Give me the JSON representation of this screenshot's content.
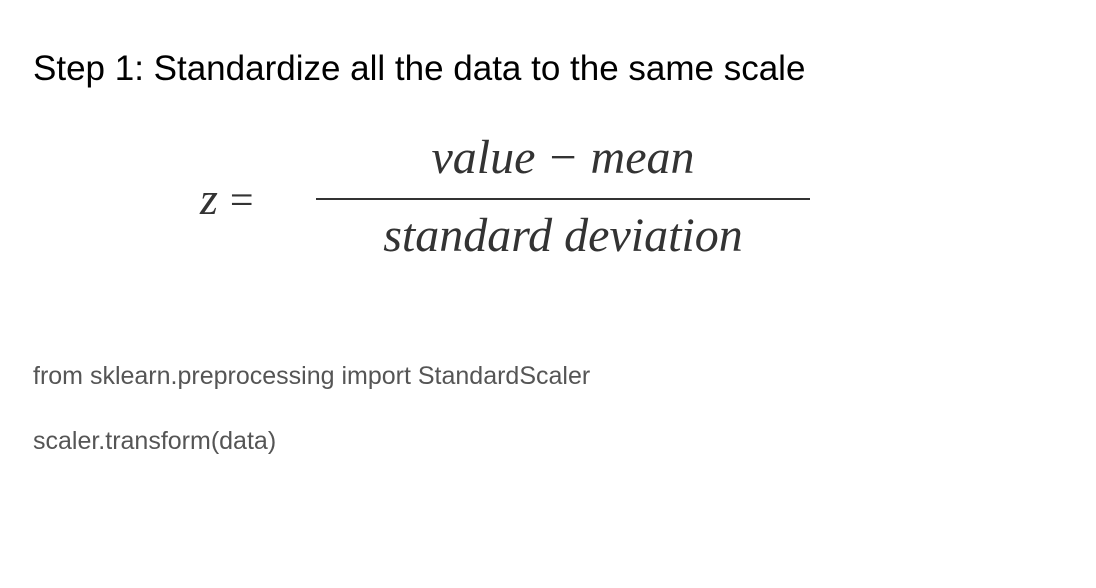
{
  "slide": {
    "heading": "Step 1: Standardize all the data to the same scale",
    "formula": {
      "lhs_variable": "z",
      "equals": "=",
      "numerator_left": "value",
      "numerator_operator": "−",
      "numerator_right": "mean",
      "denominator": "standard deviation"
    },
    "code_lines": [
      "from sklearn.preprocessing import StandardScaler",
      "scaler.transform(data)"
    ]
  },
  "colors": {
    "heading": "#000000",
    "formula": "#333333",
    "code": "#555555",
    "background": "#ffffff"
  }
}
